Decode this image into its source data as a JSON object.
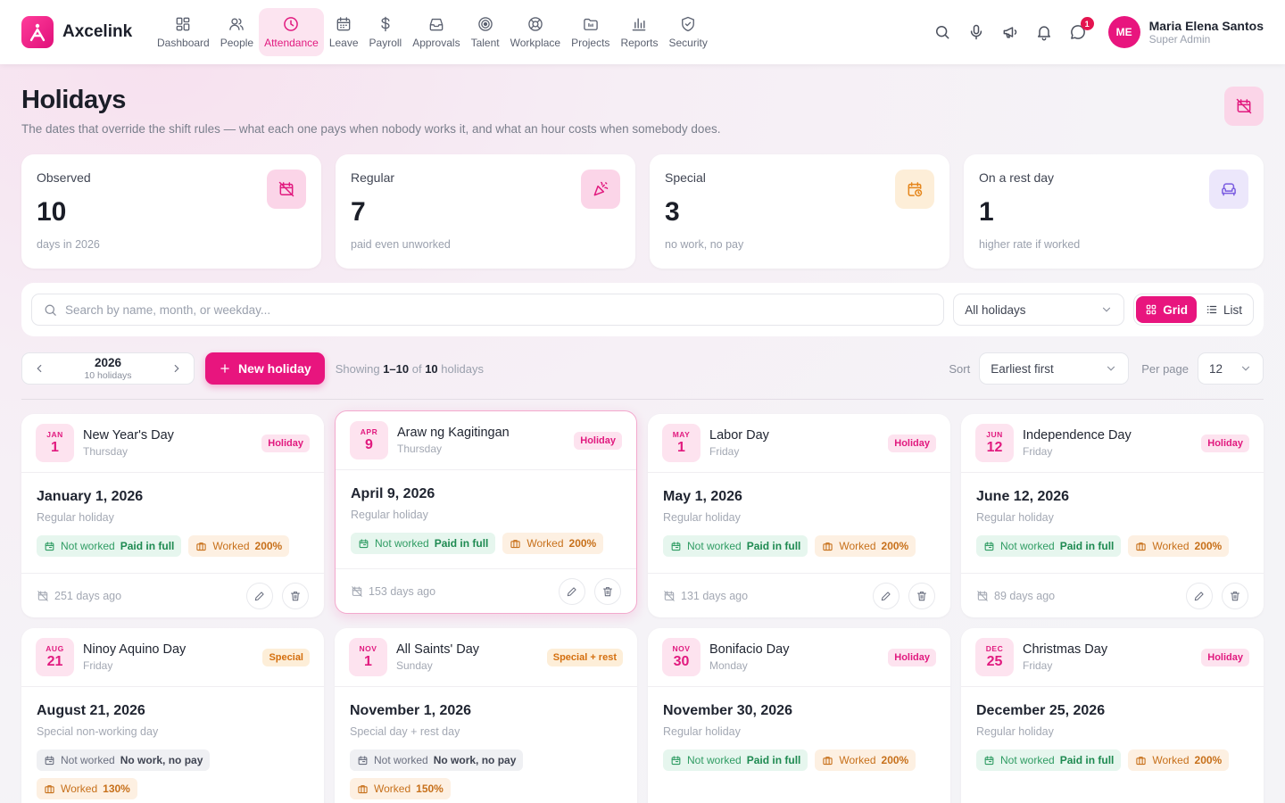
{
  "app": {
    "name": "Axcelink"
  },
  "nav": [
    {
      "label": "Dashboard",
      "icon": "dashboard-icon"
    },
    {
      "label": "People",
      "icon": "people-icon"
    },
    {
      "label": "Attendance",
      "icon": "clock-icon",
      "active": true
    },
    {
      "label": "Leave",
      "icon": "calendar-icon"
    },
    {
      "label": "Payroll",
      "icon": "dollar-icon"
    },
    {
      "label": "Approvals",
      "icon": "inbox-icon"
    },
    {
      "label": "Talent",
      "icon": "target-icon"
    },
    {
      "label": "Workplace",
      "icon": "lifebuoy-icon"
    },
    {
      "label": "Projects",
      "icon": "folder-icon"
    },
    {
      "label": "Reports",
      "icon": "bar-chart-icon"
    },
    {
      "label": "Security",
      "icon": "shield-icon"
    }
  ],
  "header_icons": {
    "messages_badge": "1"
  },
  "user": {
    "initials": "ME",
    "name": "Maria Elena Santos",
    "role": "Super Admin"
  },
  "page": {
    "title": "Holidays",
    "subtitle": "The dates that override the shift rules — what each one pays when nobody works it, and what an hour costs when somebody does."
  },
  "stats": [
    {
      "label": "Observed",
      "value": "10",
      "note": "days in 2026",
      "icon": "calendar-off-icon",
      "color": "#fbd5e8",
      "icon_color": "#e11a7f"
    },
    {
      "label": "Regular",
      "value": "7",
      "note": "paid even unworked",
      "icon": "party-popper-icon",
      "color": "#fbd5e8",
      "icon_color": "#e11a7f"
    },
    {
      "label": "Special",
      "value": "3",
      "note": "no work, no pay",
      "icon": "calendar-clock-icon",
      "color": "#fdeed8",
      "icon_color": "#e5861c"
    },
    {
      "label": "On a rest day",
      "value": "1",
      "note": "higher rate if worked",
      "icon": "sofa-icon",
      "color": "#ece7fb",
      "icon_color": "#7a5ce0"
    }
  ],
  "filters": {
    "search_placeholder": "Search by name, month, or weekday...",
    "type_select": "All holidays",
    "view_grid": "Grid",
    "view_list": "List"
  },
  "toolbar": {
    "year": "2026",
    "year_count": "10 holidays",
    "new_button": "New holiday",
    "showing_prefix": "Showing",
    "showing_range": "1–10",
    "showing_of": "of",
    "showing_total": "10",
    "showing_suffix": "holidays",
    "sort_label": "Sort",
    "sort_value": "Earliest first",
    "per_page_label": "Per page",
    "per_page_value": "12"
  },
  "holidays": [
    {
      "mon": "JAN",
      "day": "1",
      "name": "New Year's Day",
      "weekday": "Thursday",
      "tag": "Holiday",
      "tag_type": "holiday",
      "date": "January 1, 2026",
      "type": "Regular holiday",
      "not_worked_label": "Not worked",
      "not_worked_value": "Paid in full",
      "nw_type": "paid",
      "worked_label": "Worked",
      "worked_value": "200%",
      "ago": "251 days ago"
    },
    {
      "mon": "APR",
      "day": "9",
      "name": "Araw ng Kagitingan",
      "weekday": "Thursday",
      "tag": "Holiday",
      "tag_type": "holiday",
      "date": "April 9, 2026",
      "type": "Regular holiday",
      "not_worked_label": "Not worked",
      "not_worked_value": "Paid in full",
      "nw_type": "paid",
      "worked_label": "Worked",
      "worked_value": "200%",
      "ago": "153 days ago",
      "selected": true
    },
    {
      "mon": "MAY",
      "day": "1",
      "name": "Labor Day",
      "weekday": "Friday",
      "tag": "Holiday",
      "tag_type": "holiday",
      "date": "May 1, 2026",
      "type": "Regular holiday",
      "not_worked_label": "Not worked",
      "not_worked_value": "Paid in full",
      "nw_type": "paid",
      "worked_label": "Worked",
      "worked_value": "200%",
      "ago": "131 days ago"
    },
    {
      "mon": "JUN",
      "day": "12",
      "name": "Independence Day",
      "weekday": "Friday",
      "tag": "Holiday",
      "tag_type": "holiday",
      "date": "June 12, 2026",
      "type": "Regular holiday",
      "not_worked_label": "Not worked",
      "not_worked_value": "Paid in full",
      "nw_type": "paid",
      "worked_label": "Worked",
      "worked_value": "200%",
      "ago": "89 days ago"
    },
    {
      "mon": "AUG",
      "day": "21",
      "name": "Ninoy Aquino Day",
      "weekday": "Friday",
      "tag": "Special",
      "tag_type": "special",
      "date": "August 21, 2026",
      "type": "Special non-working day",
      "not_worked_label": "Not worked",
      "not_worked_value": "No work, no pay",
      "nw_type": "nopay",
      "worked_label": "Worked",
      "worked_value": "130%",
      "ago": ""
    },
    {
      "mon": "NOV",
      "day": "1",
      "name": "All Saints' Day",
      "weekday": "Sunday",
      "tag": "Special + rest",
      "tag_type": "special",
      "date": "November 1, 2026",
      "type": "Special day + rest day",
      "not_worked_label": "Not worked",
      "not_worked_value": "No work, no pay",
      "nw_type": "nopay",
      "worked_label": "Worked",
      "worked_value": "150%",
      "ago": ""
    },
    {
      "mon": "NOV",
      "day": "30",
      "name": "Bonifacio Day",
      "weekday": "Monday",
      "tag": "Holiday",
      "tag_type": "holiday",
      "date": "November 30, 2026",
      "type": "Regular holiday",
      "not_worked_label": "Not worked",
      "not_worked_value": "Paid in full",
      "nw_type": "paid",
      "worked_label": "Worked",
      "worked_value": "200%",
      "ago": ""
    },
    {
      "mon": "DEC",
      "day": "25",
      "name": "Christmas Day",
      "weekday": "Friday",
      "tag": "Holiday",
      "tag_type": "holiday",
      "date": "December 25, 2026",
      "type": "Regular holiday",
      "not_worked_label": "Not worked",
      "not_worked_value": "Paid in full",
      "nw_type": "paid",
      "worked_label": "Worked",
      "worked_value": "200%",
      "ago": ""
    }
  ],
  "colors": {
    "accent": "#e8157e",
    "accent_light": "#fde3ef",
    "paid": "#2f9c63",
    "worked": "#c7701a"
  }
}
